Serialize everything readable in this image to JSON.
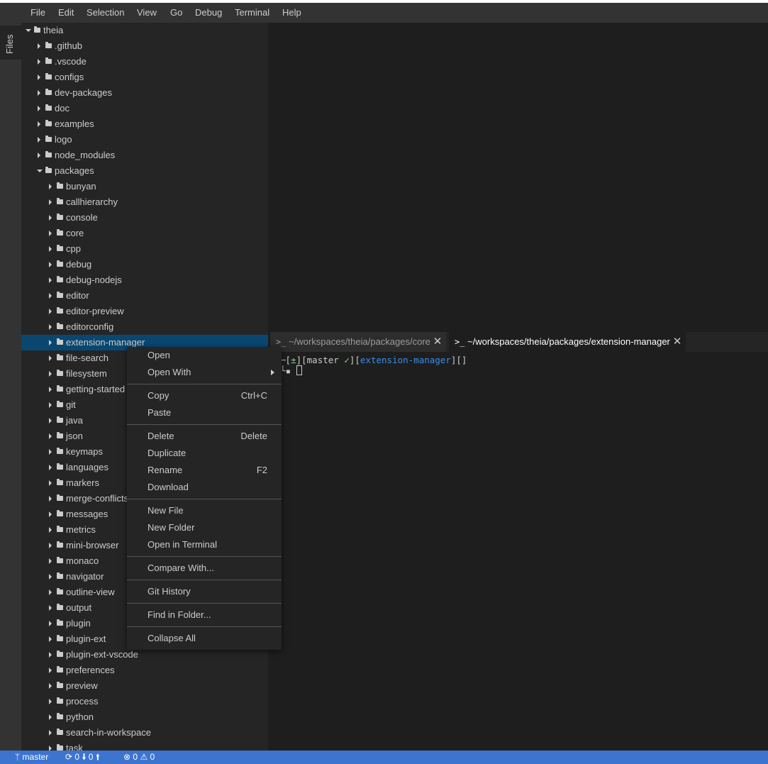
{
  "menu": [
    "File",
    "Edit",
    "Selection",
    "View",
    "Go",
    "Debug",
    "Terminal",
    "Help"
  ],
  "activity": {
    "files_label": "Files"
  },
  "tree": [
    {
      "label": "theia",
      "depth": 0,
      "open": true
    },
    {
      "label": ".github",
      "depth": 1
    },
    {
      "label": ".vscode",
      "depth": 1
    },
    {
      "label": "configs",
      "depth": 1
    },
    {
      "label": "dev-packages",
      "depth": 1
    },
    {
      "label": "doc",
      "depth": 1
    },
    {
      "label": "examples",
      "depth": 1
    },
    {
      "label": "logo",
      "depth": 1
    },
    {
      "label": "node_modules",
      "depth": 1
    },
    {
      "label": "packages",
      "depth": 1,
      "open": true
    },
    {
      "label": "bunyan",
      "depth": 2
    },
    {
      "label": "callhierarchy",
      "depth": 2
    },
    {
      "label": "console",
      "depth": 2
    },
    {
      "label": "core",
      "depth": 2
    },
    {
      "label": "cpp",
      "depth": 2
    },
    {
      "label": "debug",
      "depth": 2
    },
    {
      "label": "debug-nodejs",
      "depth": 2
    },
    {
      "label": "editor",
      "depth": 2
    },
    {
      "label": "editor-preview",
      "depth": 2
    },
    {
      "label": "editorconfig",
      "depth": 2
    },
    {
      "label": "extension-manager",
      "depth": 2,
      "selected": true
    },
    {
      "label": "file-search",
      "depth": 2
    },
    {
      "label": "filesystem",
      "depth": 2
    },
    {
      "label": "getting-started",
      "depth": 2
    },
    {
      "label": "git",
      "depth": 2
    },
    {
      "label": "java",
      "depth": 2
    },
    {
      "label": "json",
      "depth": 2
    },
    {
      "label": "keymaps",
      "depth": 2
    },
    {
      "label": "languages",
      "depth": 2
    },
    {
      "label": "markers",
      "depth": 2
    },
    {
      "label": "merge-conflicts",
      "depth": 2
    },
    {
      "label": "messages",
      "depth": 2
    },
    {
      "label": "metrics",
      "depth": 2
    },
    {
      "label": "mini-browser",
      "depth": 2
    },
    {
      "label": "monaco",
      "depth": 2
    },
    {
      "label": "navigator",
      "depth": 2
    },
    {
      "label": "outline-view",
      "depth": 2
    },
    {
      "label": "output",
      "depth": 2
    },
    {
      "label": "plugin",
      "depth": 2
    },
    {
      "label": "plugin-ext",
      "depth": 2
    },
    {
      "label": "plugin-ext-vscode",
      "depth": 2
    },
    {
      "label": "preferences",
      "depth": 2
    },
    {
      "label": "preview",
      "depth": 2
    },
    {
      "label": "process",
      "depth": 2
    },
    {
      "label": "python",
      "depth": 2
    },
    {
      "label": "search-in-workspace",
      "depth": 2
    },
    {
      "label": "task",
      "depth": 2
    }
  ],
  "terminal_tabs": [
    {
      "icon": ">_",
      "title": "~/workspaces/theia/packages/core",
      "active": false
    },
    {
      "icon": ">_",
      "title": "~/workspaces/theia/packages/extension-manager",
      "active": true
    }
  ],
  "terminal": {
    "line1_prefix": "─[",
    "line1_flag": "±",
    "line1_mid": "][master ",
    "line1_check": "✓",
    "line1_mid2": "][",
    "line1_dir": "extension-manager",
    "line1_end": "][]",
    "line2_prompt": "└▪ "
  },
  "context_menu": [
    {
      "label": "Open"
    },
    {
      "label": "Open With",
      "submenu": true
    },
    {
      "sep": true
    },
    {
      "label": "Copy",
      "shortcut": "Ctrl+C"
    },
    {
      "label": "Paste"
    },
    {
      "sep": true
    },
    {
      "label": "Delete",
      "shortcut": "Delete"
    },
    {
      "label": "Duplicate"
    },
    {
      "label": "Rename",
      "shortcut": "F2"
    },
    {
      "label": "Download"
    },
    {
      "sep": true
    },
    {
      "label": "New File"
    },
    {
      "label": "New Folder"
    },
    {
      "label": "Open in Terminal"
    },
    {
      "sep": true
    },
    {
      "label": "Compare With..."
    },
    {
      "sep": true
    },
    {
      "label": "Git History"
    },
    {
      "sep": true
    },
    {
      "label": "Find in Folder..."
    },
    {
      "sep": true
    },
    {
      "label": "Collapse All"
    }
  ],
  "status": {
    "branch_icon": "ᛘ",
    "branch": "master",
    "sync_icon": "⟳",
    "incoming": "0",
    "down_icon": "🠛",
    "outgoing": "0",
    "up_icon": "🠙",
    "error_icon": "⊗",
    "errors": "0",
    "warning_icon": "⚠",
    "warnings": "0"
  }
}
